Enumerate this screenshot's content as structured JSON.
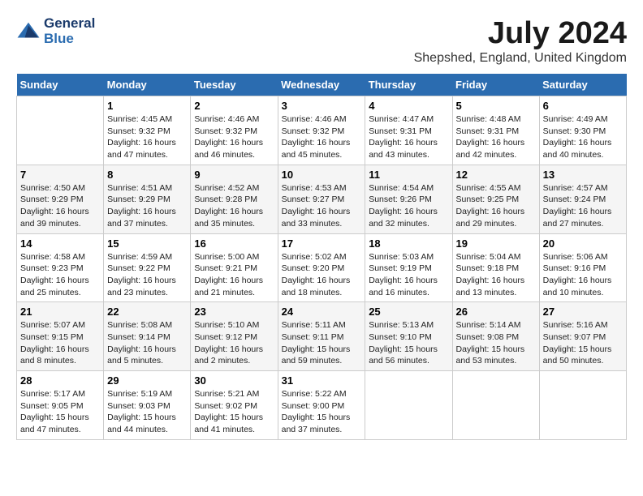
{
  "header": {
    "logo_line1": "General",
    "logo_line2": "Blue",
    "title": "July 2024",
    "subtitle": "Shepshed, England, United Kingdom"
  },
  "days_of_week": [
    "Sunday",
    "Monday",
    "Tuesday",
    "Wednesday",
    "Thursday",
    "Friday",
    "Saturday"
  ],
  "weeks": [
    [
      {
        "day": "",
        "sunrise": "",
        "sunset": "",
        "daylight": ""
      },
      {
        "day": "1",
        "sunrise": "Sunrise: 4:45 AM",
        "sunset": "Sunset: 9:32 PM",
        "daylight": "Daylight: 16 hours and 47 minutes."
      },
      {
        "day": "2",
        "sunrise": "Sunrise: 4:46 AM",
        "sunset": "Sunset: 9:32 PM",
        "daylight": "Daylight: 16 hours and 46 minutes."
      },
      {
        "day": "3",
        "sunrise": "Sunrise: 4:46 AM",
        "sunset": "Sunset: 9:32 PM",
        "daylight": "Daylight: 16 hours and 45 minutes."
      },
      {
        "day": "4",
        "sunrise": "Sunrise: 4:47 AM",
        "sunset": "Sunset: 9:31 PM",
        "daylight": "Daylight: 16 hours and 43 minutes."
      },
      {
        "day": "5",
        "sunrise": "Sunrise: 4:48 AM",
        "sunset": "Sunset: 9:31 PM",
        "daylight": "Daylight: 16 hours and 42 minutes."
      },
      {
        "day": "6",
        "sunrise": "Sunrise: 4:49 AM",
        "sunset": "Sunset: 9:30 PM",
        "daylight": "Daylight: 16 hours and 40 minutes."
      }
    ],
    [
      {
        "day": "7",
        "sunrise": "Sunrise: 4:50 AM",
        "sunset": "Sunset: 9:29 PM",
        "daylight": "Daylight: 16 hours and 39 minutes."
      },
      {
        "day": "8",
        "sunrise": "Sunrise: 4:51 AM",
        "sunset": "Sunset: 9:29 PM",
        "daylight": "Daylight: 16 hours and 37 minutes."
      },
      {
        "day": "9",
        "sunrise": "Sunrise: 4:52 AM",
        "sunset": "Sunset: 9:28 PM",
        "daylight": "Daylight: 16 hours and 35 minutes."
      },
      {
        "day": "10",
        "sunrise": "Sunrise: 4:53 AM",
        "sunset": "Sunset: 9:27 PM",
        "daylight": "Daylight: 16 hours and 33 minutes."
      },
      {
        "day": "11",
        "sunrise": "Sunrise: 4:54 AM",
        "sunset": "Sunset: 9:26 PM",
        "daylight": "Daylight: 16 hours and 32 minutes."
      },
      {
        "day": "12",
        "sunrise": "Sunrise: 4:55 AM",
        "sunset": "Sunset: 9:25 PM",
        "daylight": "Daylight: 16 hours and 29 minutes."
      },
      {
        "day": "13",
        "sunrise": "Sunrise: 4:57 AM",
        "sunset": "Sunset: 9:24 PM",
        "daylight": "Daylight: 16 hours and 27 minutes."
      }
    ],
    [
      {
        "day": "14",
        "sunrise": "Sunrise: 4:58 AM",
        "sunset": "Sunset: 9:23 PM",
        "daylight": "Daylight: 16 hours and 25 minutes."
      },
      {
        "day": "15",
        "sunrise": "Sunrise: 4:59 AM",
        "sunset": "Sunset: 9:22 PM",
        "daylight": "Daylight: 16 hours and 23 minutes."
      },
      {
        "day": "16",
        "sunrise": "Sunrise: 5:00 AM",
        "sunset": "Sunset: 9:21 PM",
        "daylight": "Daylight: 16 hours and 21 minutes."
      },
      {
        "day": "17",
        "sunrise": "Sunrise: 5:02 AM",
        "sunset": "Sunset: 9:20 PM",
        "daylight": "Daylight: 16 hours and 18 minutes."
      },
      {
        "day": "18",
        "sunrise": "Sunrise: 5:03 AM",
        "sunset": "Sunset: 9:19 PM",
        "daylight": "Daylight: 16 hours and 16 minutes."
      },
      {
        "day": "19",
        "sunrise": "Sunrise: 5:04 AM",
        "sunset": "Sunset: 9:18 PM",
        "daylight": "Daylight: 16 hours and 13 minutes."
      },
      {
        "day": "20",
        "sunrise": "Sunrise: 5:06 AM",
        "sunset": "Sunset: 9:16 PM",
        "daylight": "Daylight: 16 hours and 10 minutes."
      }
    ],
    [
      {
        "day": "21",
        "sunrise": "Sunrise: 5:07 AM",
        "sunset": "Sunset: 9:15 PM",
        "daylight": "Daylight: 16 hours and 8 minutes."
      },
      {
        "day": "22",
        "sunrise": "Sunrise: 5:08 AM",
        "sunset": "Sunset: 9:14 PM",
        "daylight": "Daylight: 16 hours and 5 minutes."
      },
      {
        "day": "23",
        "sunrise": "Sunrise: 5:10 AM",
        "sunset": "Sunset: 9:12 PM",
        "daylight": "Daylight: 16 hours and 2 minutes."
      },
      {
        "day": "24",
        "sunrise": "Sunrise: 5:11 AM",
        "sunset": "Sunset: 9:11 PM",
        "daylight": "Daylight: 15 hours and 59 minutes."
      },
      {
        "day": "25",
        "sunrise": "Sunrise: 5:13 AM",
        "sunset": "Sunset: 9:10 PM",
        "daylight": "Daylight: 15 hours and 56 minutes."
      },
      {
        "day": "26",
        "sunrise": "Sunrise: 5:14 AM",
        "sunset": "Sunset: 9:08 PM",
        "daylight": "Daylight: 15 hours and 53 minutes."
      },
      {
        "day": "27",
        "sunrise": "Sunrise: 5:16 AM",
        "sunset": "Sunset: 9:07 PM",
        "daylight": "Daylight: 15 hours and 50 minutes."
      }
    ],
    [
      {
        "day": "28",
        "sunrise": "Sunrise: 5:17 AM",
        "sunset": "Sunset: 9:05 PM",
        "daylight": "Daylight: 15 hours and 47 minutes."
      },
      {
        "day": "29",
        "sunrise": "Sunrise: 5:19 AM",
        "sunset": "Sunset: 9:03 PM",
        "daylight": "Daylight: 15 hours and 44 minutes."
      },
      {
        "day": "30",
        "sunrise": "Sunrise: 5:21 AM",
        "sunset": "Sunset: 9:02 PM",
        "daylight": "Daylight: 15 hours and 41 minutes."
      },
      {
        "day": "31",
        "sunrise": "Sunrise: 5:22 AM",
        "sunset": "Sunset: 9:00 PM",
        "daylight": "Daylight: 15 hours and 37 minutes."
      },
      {
        "day": "",
        "sunrise": "",
        "sunset": "",
        "daylight": ""
      },
      {
        "day": "",
        "sunrise": "",
        "sunset": "",
        "daylight": ""
      },
      {
        "day": "",
        "sunrise": "",
        "sunset": "",
        "daylight": ""
      }
    ]
  ]
}
